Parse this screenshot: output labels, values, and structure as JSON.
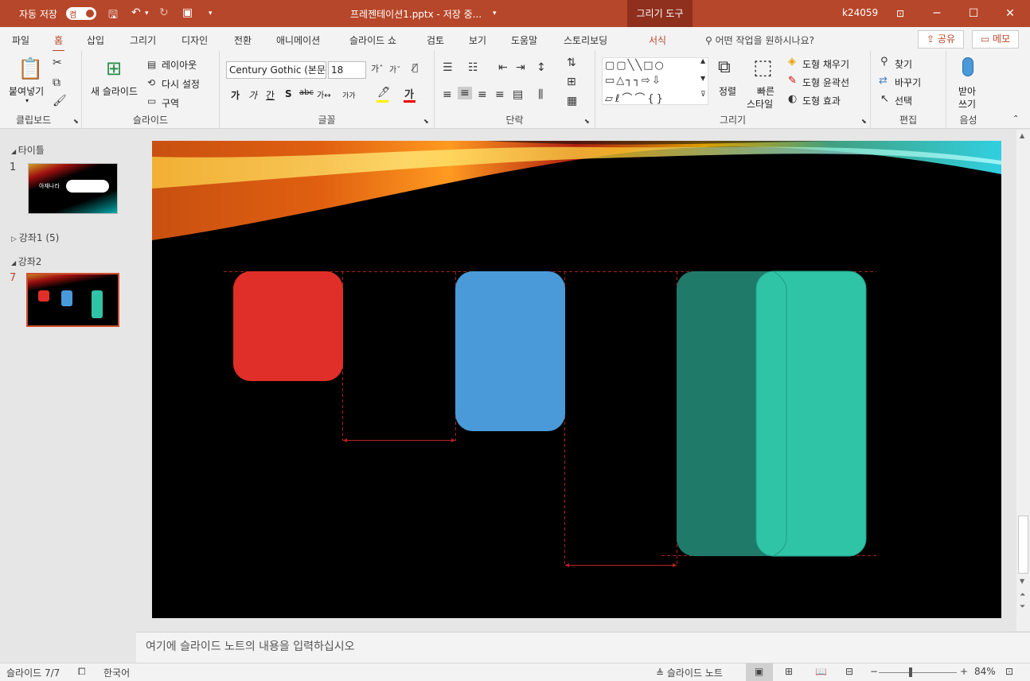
{
  "titlebar": {
    "autosave_label": "자동 저장",
    "autosave_state": "켬",
    "document_title": "프레젠테이션1.pptx  -  저장 중...",
    "context_tab": "그리기 도구",
    "user": "k24059"
  },
  "tabs": [
    "파일",
    "홈",
    "삽입",
    "그리기",
    "디자인",
    "전환",
    "애니메이션",
    "슬라이드 쇼",
    "검토",
    "보기",
    "도움말",
    "스토리보딩",
    "서식"
  ],
  "tellme": "어떤 작업을 원하시나요?",
  "share_label": "공유",
  "comment_label": "메모",
  "ribbon": {
    "clipboard": {
      "label": "클립보드",
      "paste": "붙여넣기"
    },
    "slides": {
      "label": "슬라이드",
      "new_slide": "새 슬라이드",
      "layout": "레이아웃",
      "reset": "다시 설정",
      "section": "구역"
    },
    "font": {
      "label": "글꼴",
      "font_name": "Century Gothic (본문",
      "font_size": "18",
      "font_btns": [
        "가",
        "가",
        "간",
        "S",
        "abc",
        "가↔",
        "가가"
      ]
    },
    "paragraph": {
      "label": "단락"
    },
    "drawing": {
      "label": "그리기",
      "arrange": "정렬",
      "quick_styles_1": "빠른",
      "quick_styles_2": "스타일",
      "fill": "도형 채우기",
      "outline": "도형 윤곽선",
      "effects": "도형 효과"
    },
    "editing": {
      "label": "편집",
      "find": "찾기",
      "replace": "바꾸기",
      "select": "선택"
    },
    "voice": {
      "label": "음성",
      "dictate_1": "받아",
      "dictate_2": "쓰기"
    }
  },
  "panel": {
    "section_title": "타이틀",
    "section_a": "강좌1 (5)",
    "section_b": "강좌2",
    "slide1_num": "1",
    "slide7_num": "7",
    "thumb1_title": "아재나라"
  },
  "notes_placeholder": "여기에 슬라이드 노트의 내용을 입력하십시오",
  "status": {
    "slide": "슬라이드 7/7",
    "language": "한국어",
    "notes": "슬라이드 노트",
    "zoom": "84%"
  },
  "colors": {
    "accent": "#b7472a",
    "red_shape": "#e02f28",
    "blue_shape": "#4a9ad9",
    "teal_dark": "#1f7a69",
    "teal_light": "#2fc4a6"
  }
}
